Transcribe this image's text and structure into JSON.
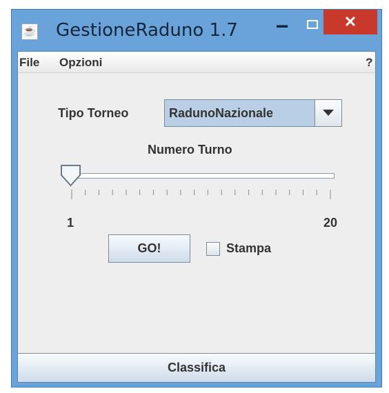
{
  "window": {
    "title": "GestioneRaduno 1.7",
    "controls": {
      "minimize": "−",
      "close": "✕"
    }
  },
  "menubar": {
    "file": "File",
    "opzioni": "Opzioni",
    "help": "?"
  },
  "form": {
    "tipo_torneo_label": "Tipo Torneo",
    "tipo_torneo_value": "RadunoNazionale",
    "numero_turno_label": "Numero Turno",
    "slider": {
      "min": 1,
      "max": 20,
      "value": 1,
      "min_label": "1",
      "max_label": "20"
    },
    "go_label": "GO!",
    "stampa_label": "Stampa",
    "stampa_checked": false
  },
  "footer": {
    "classifica_label": "Classifica"
  },
  "colors": {
    "titlebar": "#6aa3d9",
    "close": "#c8392b",
    "panel": "#eeeeee",
    "combo": "#b8cfe5"
  },
  "icons": {
    "app": "java-icon"
  }
}
